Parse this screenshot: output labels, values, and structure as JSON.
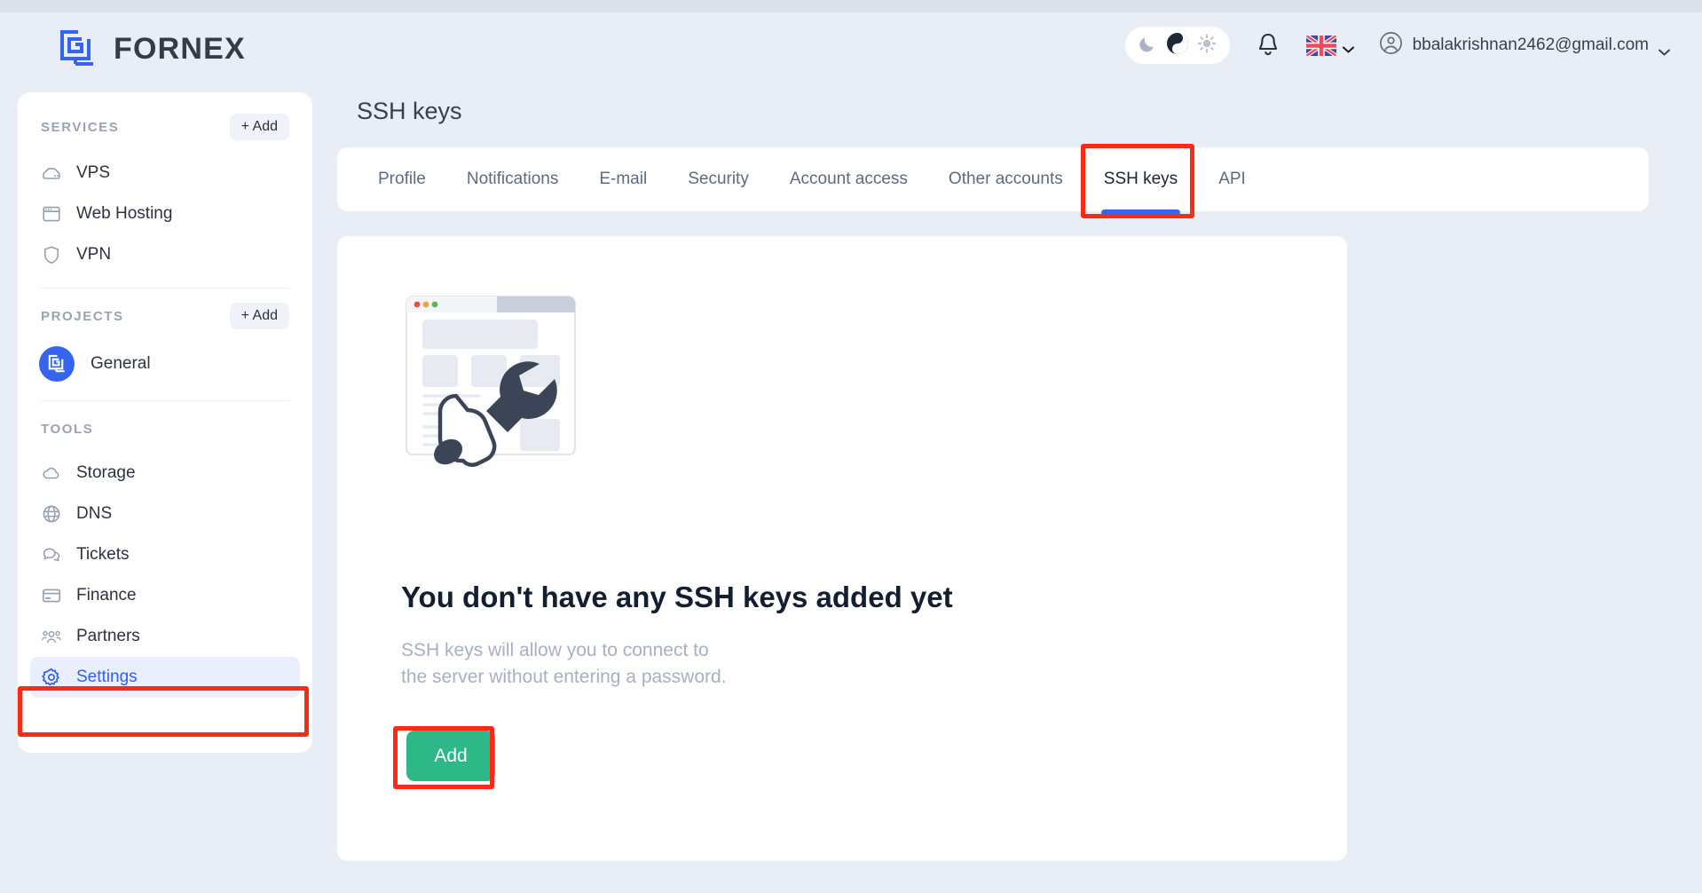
{
  "header": {
    "brand": "FORNEX",
    "brand_icon": "fornex-logo-icon",
    "theme_toggle": {
      "moon_icon": "moon-icon",
      "auto_icon": "yin-yang-icon",
      "sun_icon": "sun-icon"
    },
    "notifications_icon": "bell-icon",
    "language": {
      "flag": "uk-flag-icon",
      "chevron": "chevron-down-icon"
    },
    "user": {
      "avatar_icon": "user-circle-icon",
      "email": "bbalakrishnan2462@gmail.com",
      "chevron": "chevron-down-icon"
    }
  },
  "sidebar": {
    "services": {
      "title": "SERVICES",
      "add_label": "+ Add",
      "items": [
        {
          "label": "VPS",
          "icon": "server-icon"
        },
        {
          "label": "Web Hosting",
          "icon": "browser-window-icon"
        },
        {
          "label": "VPN",
          "icon": "shield-icon"
        }
      ]
    },
    "projects": {
      "title": "PROJECTS",
      "add_label": "+ Add",
      "items": [
        {
          "label": "General",
          "icon": "fornex-logo-icon",
          "avatar_color": "#3565ef"
        }
      ]
    },
    "tools": {
      "title": "TOOLS",
      "items": [
        {
          "label": "Storage",
          "icon": "cloud-icon",
          "active": false
        },
        {
          "label": "DNS",
          "icon": "globe-icon",
          "active": false
        },
        {
          "label": "Tickets",
          "icon": "chat-bubbles-icon",
          "active": false
        },
        {
          "label": "Finance",
          "icon": "credit-card-icon",
          "active": false
        },
        {
          "label": "Partners",
          "icon": "people-icon",
          "active": false
        },
        {
          "label": "Settings",
          "icon": "gear-icon",
          "active": true
        }
      ]
    }
  },
  "main": {
    "page_title": "SSH keys",
    "tabs": [
      {
        "label": "Profile",
        "active": false
      },
      {
        "label": "Notifications",
        "active": false
      },
      {
        "label": "E-mail",
        "active": false
      },
      {
        "label": "Security",
        "active": false
      },
      {
        "label": "Account access",
        "active": false
      },
      {
        "label": "Other accounts",
        "active": false
      },
      {
        "label": "SSH keys",
        "active": true
      },
      {
        "label": "API",
        "active": false
      }
    ],
    "empty_state": {
      "illustration": "browser-window-with-wrench-illustration",
      "title": "You don't have any SSH keys added yet",
      "description_line1": "SSH keys will allow you to connect to",
      "description_line2": "the server without entering a password.",
      "add_button_label": "Add"
    }
  },
  "annotations": {
    "settings_highlight": "red-box-around-settings-nav-item",
    "ssh_tab_highlight": "red-box-around-ssh-keys-tab",
    "add_button_highlight": "red-box-around-add-button"
  },
  "colors": {
    "page_background": "#e9edf6",
    "card": "#ffffff",
    "accent_blue": "#3565ef",
    "accent_green": "#2eb888",
    "annotation_red": "#fa2a17",
    "text_dark": "#2b3240",
    "text_muted": "#a7b0c2"
  }
}
